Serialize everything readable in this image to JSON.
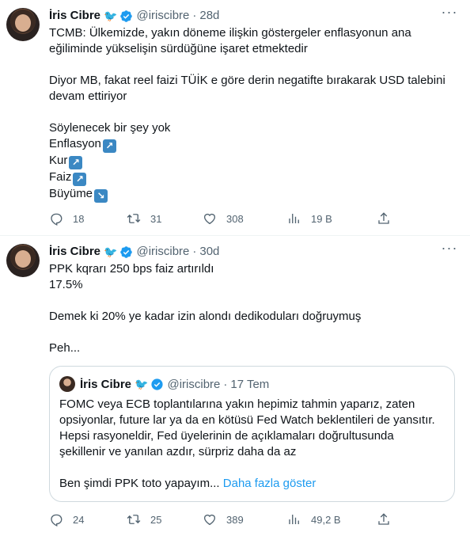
{
  "tweets": [
    {
      "name": "İris Cibre",
      "handle": "@iriscibre",
      "dot": "·",
      "time": "28d",
      "lines": [
        "TCMB: Ülkemizde, yakın döneme ilişkin göstergeler enflasyonun ana",
        "eğiliminde yükselişin sürdüğüne işaret etmektedir",
        "",
        "Diyor MB, fakat reel faizi TÜİK e göre derin negatifte bırakarak USD talebini",
        "devam ettiriyor",
        "",
        "Söylenecek bir şey yok"
      ],
      "list": [
        {
          "label": "Enflasyon",
          "arrow": "↗"
        },
        {
          "label": "Kur",
          "arrow": "↗"
        },
        {
          "label": "Faiz",
          "arrow": "↗"
        },
        {
          "label": "Büyüme",
          "arrow": "↘"
        }
      ],
      "replies": "18",
      "retweets": "31",
      "likes": "308",
      "views": "19 B"
    },
    {
      "name": "İris Cibre",
      "handle": "@iriscibre",
      "dot": "·",
      "time": "30d",
      "lines": [
        "PPK kqrarı 250 bps faiz artırıldı",
        "17.5%",
        "",
        "Demek ki 20% ye kadar izin alondı dedikoduları doğruymuş",
        "",
        "Peh..."
      ],
      "quote": {
        "name": "İris Cibre",
        "handle": "@iriscibre",
        "dot": "·",
        "time": "17 Tem",
        "lines": [
          "FOMC veya ECB toplantılarına yakın hepimiz tahmin yaparız, zaten",
          "opsiyonlar, future lar ya da en kötüsü Fed Watch beklentileri de yansıtır.",
          "Hepsi rasyoneldir, Fed üyelerinin de açıklamaları doğrultusunda",
          "şekillenir ve yanılan azdır, sürpriz daha da az",
          ""
        ],
        "last_line": "Ben şimdi PPK toto yapayım...",
        "show_more": "Daha fazla göster"
      },
      "replies": "24",
      "retweets": "25",
      "likes": "389",
      "views": "49,2 B"
    }
  ],
  "colors": {
    "accent": "#1d9bf0",
    "muted": "#536471",
    "bird": "#d7263d",
    "emoji_bg": "#3b88c3"
  }
}
